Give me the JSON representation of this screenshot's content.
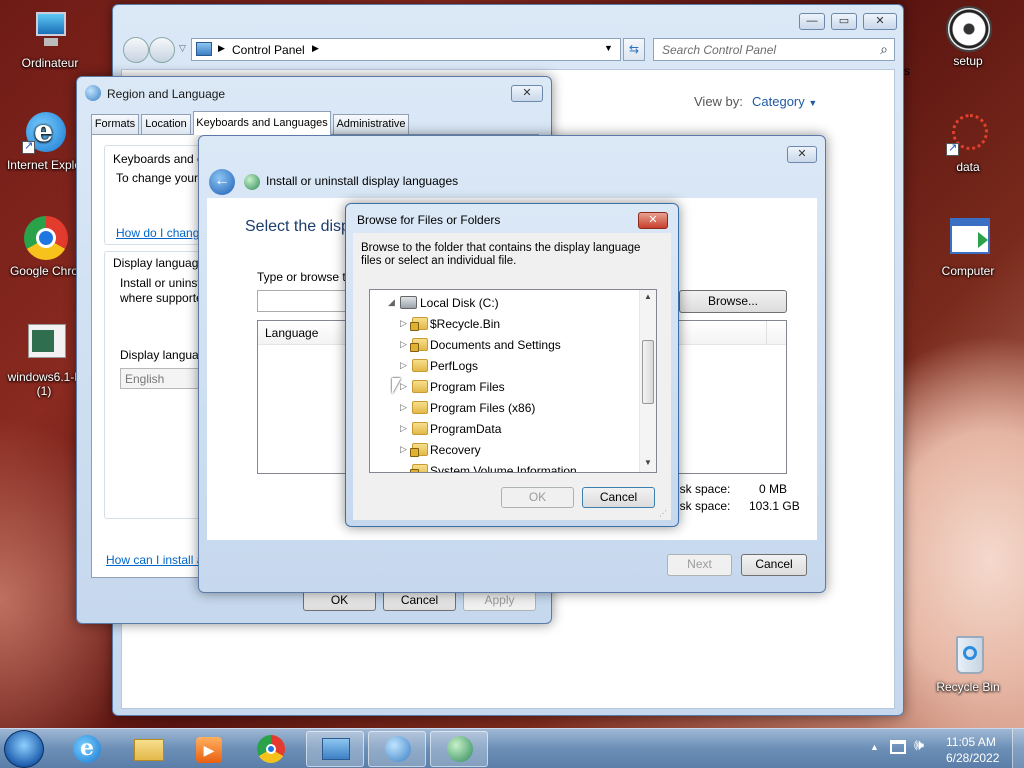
{
  "desktop": {
    "icons": [
      {
        "label": "Ordinateur",
        "icon": "computer-icon"
      },
      {
        "label": "Internet Explo",
        "icon": "internet-explorer-icon"
      },
      {
        "label": "Google Chro",
        "icon": "chrome-icon"
      },
      {
        "label": "windows6.1-k",
        "label2": "(1)",
        "icon": "file-icon"
      },
      {
        "label": "setup",
        "icon": "disc-icon"
      },
      {
        "label": "data",
        "icon": "data-icon"
      },
      {
        "label": "Computer",
        "icon": "computer-window-icon"
      },
      {
        "label": "Recycle Bin",
        "icon": "recycle-bin-icon"
      }
    ]
  },
  "control_panel": {
    "address": "Control Panel",
    "search_placeholder": "Search Control Panel",
    "view_by_label": "View by:",
    "view_by_value": "Category",
    "partial_text": "s"
  },
  "region": {
    "title": "Region and Language",
    "tabs": [
      "Formats",
      "Location",
      "Keyboards and Languages",
      "Administrative"
    ],
    "kb_heading": "Keyboards and o",
    "kb_text": "To change your",
    "kb_link": "How do I chang",
    "display_heading": "Display language",
    "display_text1": "Install or uninst",
    "display_text2": "where supporte",
    "display_select_label": "Display languag",
    "display_select_value": "English",
    "install_link": "How can I install a",
    "ok": "OK",
    "cancel": "Cancel",
    "apply": "Apply"
  },
  "install": {
    "title": "Install or uninstall display languages",
    "heading": "Select the disp",
    "type_label": "Type or browse t",
    "browse": "Browse...",
    "col_language": "Language",
    "disk_label1": "isk space:",
    "disk_value1": "0 MB",
    "disk_label2": "isk space:",
    "disk_value2": "103.1 GB",
    "next": "Next",
    "cancel": "Cancel"
  },
  "browse_dialog": {
    "title": "Browse for Files or Folders",
    "description": "Browse to the folder that contains the display language files or select an individual file.",
    "tree": [
      {
        "label": "Local Disk (C:)",
        "icon": "drive-icon",
        "expanded": true,
        "level": 0
      },
      {
        "label": "$Recycle.Bin",
        "icon": "locked-folder-icon",
        "level": 1
      },
      {
        "label": "Documents and Settings",
        "icon": "locked-folder-icon",
        "level": 1
      },
      {
        "label": "PerfLogs",
        "icon": "folder-icon",
        "level": 1
      },
      {
        "label": "Program Files",
        "icon": "folder-icon",
        "level": 1
      },
      {
        "label": "Program Files (x86)",
        "icon": "folder-icon",
        "level": 1
      },
      {
        "label": "ProgramData",
        "icon": "folder-icon",
        "level": 1
      },
      {
        "label": "Recovery",
        "icon": "locked-folder-icon",
        "level": 1
      },
      {
        "label": "System Volume Information",
        "icon": "locked-folder-icon",
        "level": 1
      }
    ],
    "ok": "OK",
    "cancel": "Cancel"
  },
  "taskbar": {
    "time": "11:05 AM",
    "date": "6/28/2022"
  }
}
